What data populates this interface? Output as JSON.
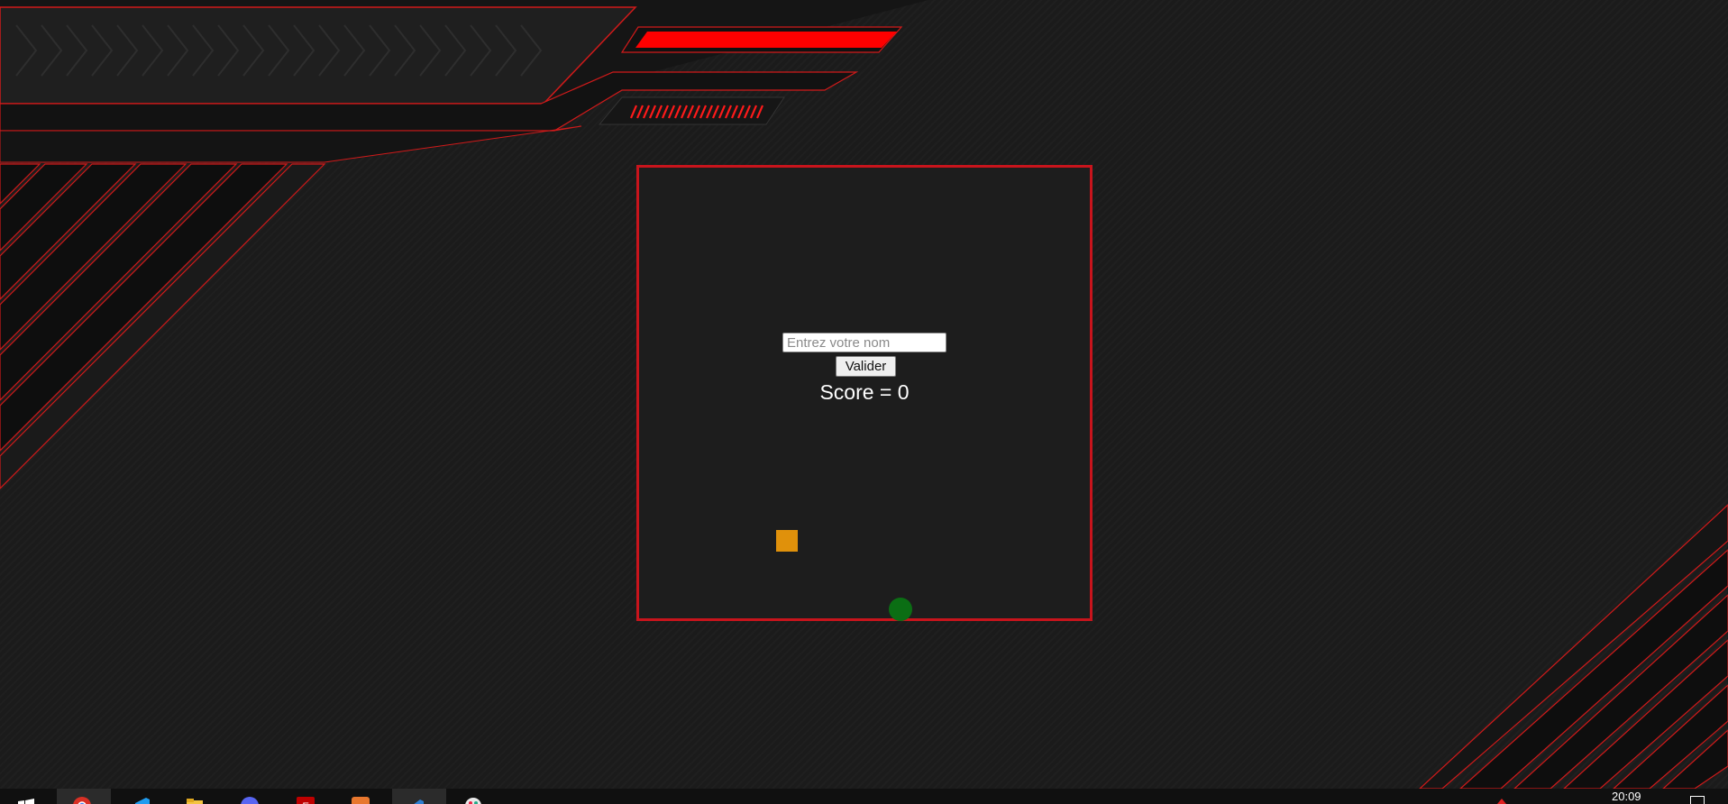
{
  "game": {
    "name_placeholder": "Entrez votre nom",
    "name_value": "",
    "validate_label": "Valider",
    "score_label": "Score = 0",
    "score": 0
  },
  "taskbar": {
    "clock": "20:09",
    "apps": [
      "start-icon",
      "chrome-icon",
      "vscode-icon",
      "file-explorer-icon",
      "discord-icon",
      "filezilla-icon",
      "sublime-icon",
      "visual-studio-icon",
      "paint-icon"
    ]
  },
  "colors": {
    "accent": "#c8141c",
    "background": "#1b1b1b",
    "food": "#e0910b",
    "player": "#0b6e14"
  }
}
